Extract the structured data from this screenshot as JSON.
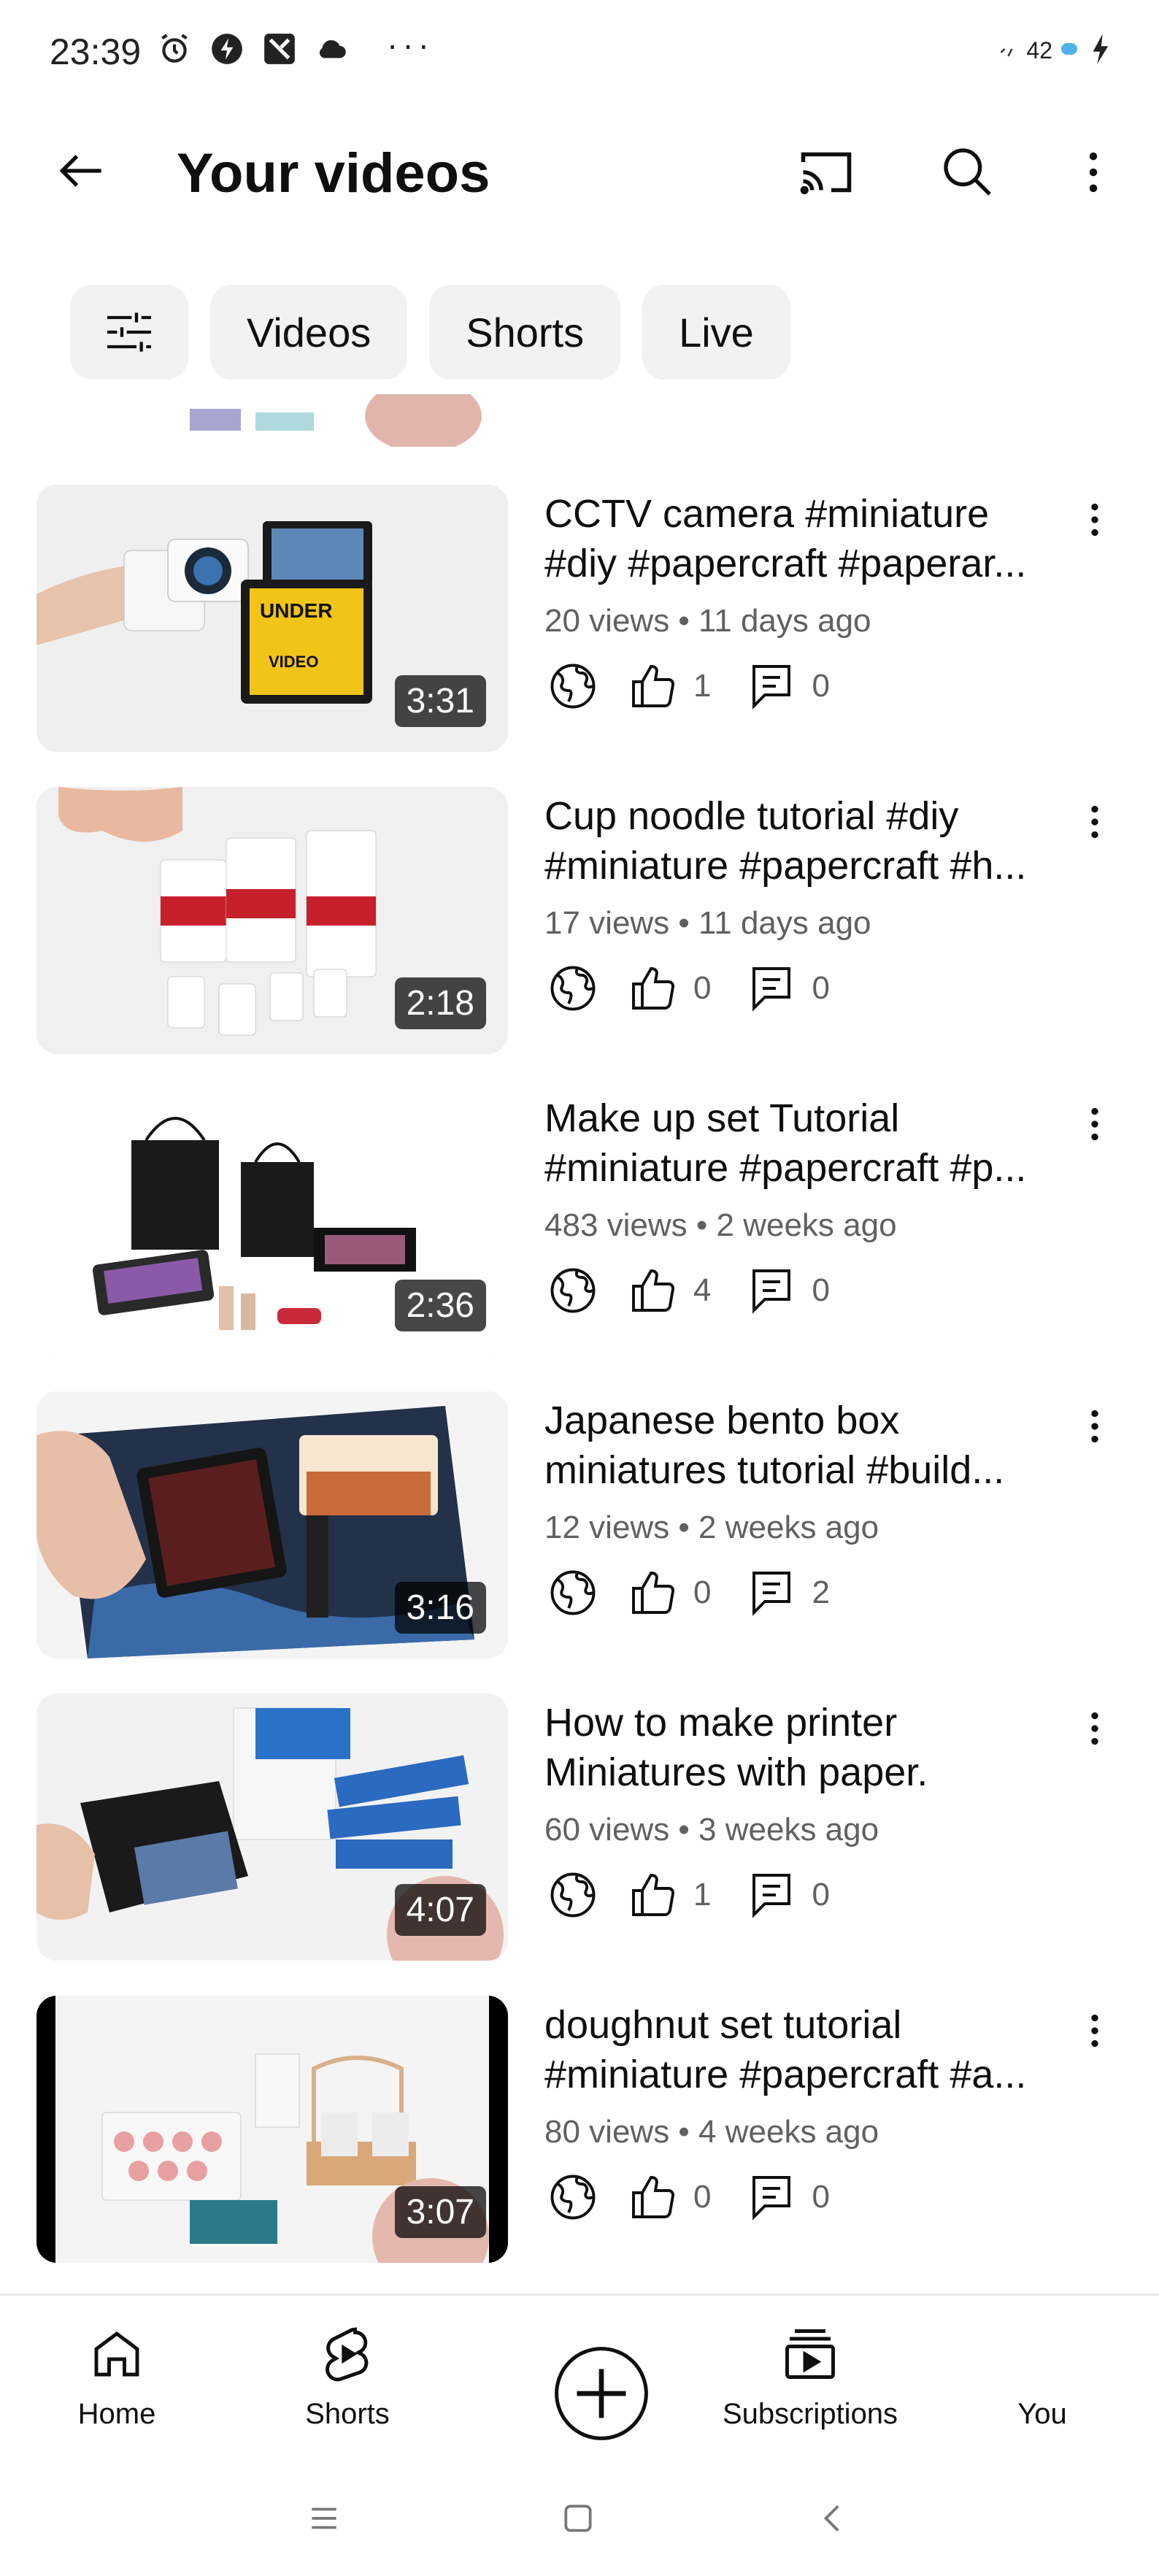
{
  "status_bar": {
    "time": "23:39",
    "more": "···",
    "battery": "42"
  },
  "app_bar": {
    "title": "Your videos"
  },
  "chips": [
    "Videos",
    "Shorts",
    "Live"
  ],
  "videos": [
    {
      "title_line1": "CCTV camera #miniature",
      "title_line2": "#diy #papercraft #paperar...",
      "meta": "20 views • 11 days ago",
      "likes": "1",
      "comments": "0",
      "duration": "3:31"
    },
    {
      "title_line1": "Cup noodle tutorial #diy",
      "title_line2": "#miniature #papercraft #h...",
      "meta": "17 views • 11 days ago",
      "likes": "0",
      "comments": "0",
      "duration": "2:18"
    },
    {
      "title_line1": "Make up set Tutorial",
      "title_line2": "#miniature #papercraft #p...",
      "meta": "483 views • 2 weeks ago",
      "likes": "4",
      "comments": "0",
      "duration": "2:36"
    },
    {
      "title_line1": "Japanese bento box",
      "title_line2": "miniatures tutorial #build...",
      "meta": "12 views • 2 weeks ago",
      "likes": "0",
      "comments": "2",
      "duration": "3:16"
    },
    {
      "title_line1": "How to make printer",
      "title_line2": "Miniatures with paper.",
      "meta": "60 views • 3 weeks ago",
      "likes": "1",
      "comments": "0",
      "duration": "4:07"
    },
    {
      "title_line1": "doughnut set tutorial",
      "title_line2": "#miniature #papercraft #a...",
      "meta": "80 views • 4 weeks ago",
      "likes": "0",
      "comments": "0",
      "duration": "3:07"
    }
  ],
  "bottom_nav": {
    "home": "Home",
    "shorts": "Shorts",
    "subscriptions": "Subscriptions",
    "you": "You"
  },
  "colors": {
    "text": "#0f0f0f",
    "secondary": "#606060",
    "chip_bg": "#f2f2f2"
  }
}
